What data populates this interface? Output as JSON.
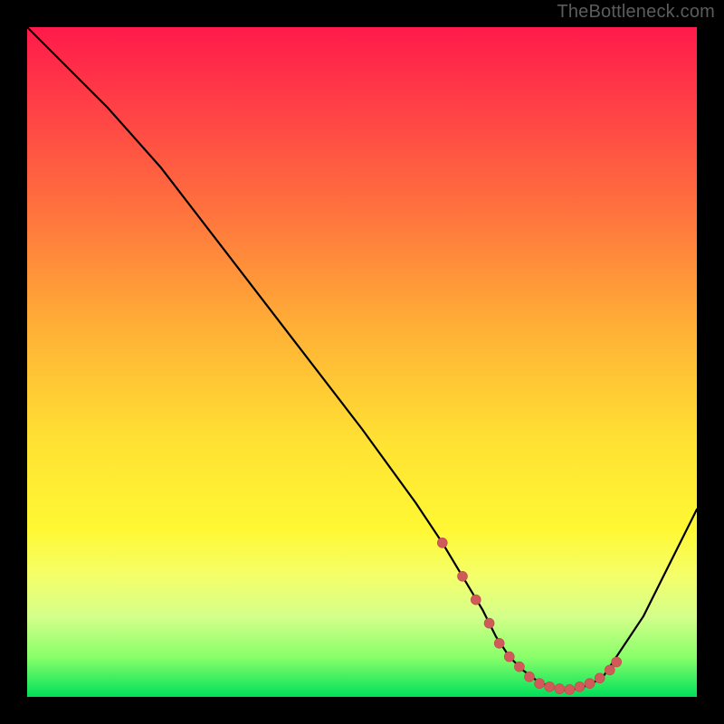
{
  "attribution": "TheBottleneck.com",
  "colors": {
    "background": "#000000",
    "gradient_top": "#ff1a4b",
    "gradient_bottom": "#00e05a",
    "curve": "#000000",
    "markers": "#d05a5a"
  },
  "chart_data": {
    "type": "line",
    "title": "",
    "xlabel": "",
    "ylabel": "",
    "xlim": [
      0,
      100
    ],
    "ylim": [
      0,
      100
    ],
    "series": [
      {
        "name": "bottleneck-curve",
        "x": [
          0,
          6,
          12,
          20,
          30,
          40,
          50,
          58,
          62,
          65,
          68,
          70,
          72,
          74,
          76,
          78,
          80,
          82,
          84,
          86,
          88,
          92,
          96,
          100
        ],
        "values": [
          100,
          94,
          88,
          79,
          66,
          53,
          40,
          29,
          23,
          18,
          13,
          9,
          6,
          4,
          2.5,
          1.5,
          1,
          1.2,
          1.8,
          3,
          6,
          12,
          20,
          28
        ]
      }
    ],
    "markers": {
      "name": "highlighted-range",
      "points": [
        {
          "x": 62,
          "y": 23
        },
        {
          "x": 65,
          "y": 18
        },
        {
          "x": 67,
          "y": 14.5
        },
        {
          "x": 69,
          "y": 11
        },
        {
          "x": 70.5,
          "y": 8
        },
        {
          "x": 72,
          "y": 6
        },
        {
          "x": 73.5,
          "y": 4.5
        },
        {
          "x": 75,
          "y": 3
        },
        {
          "x": 76.5,
          "y": 2
        },
        {
          "x": 78,
          "y": 1.5
        },
        {
          "x": 79.5,
          "y": 1.2
        },
        {
          "x": 81,
          "y": 1.1
        },
        {
          "x": 82.5,
          "y": 1.5
        },
        {
          "x": 84,
          "y": 2
        },
        {
          "x": 85.5,
          "y": 2.8
        },
        {
          "x": 87,
          "y": 4
        },
        {
          "x": 88,
          "y": 5.2
        }
      ]
    }
  }
}
